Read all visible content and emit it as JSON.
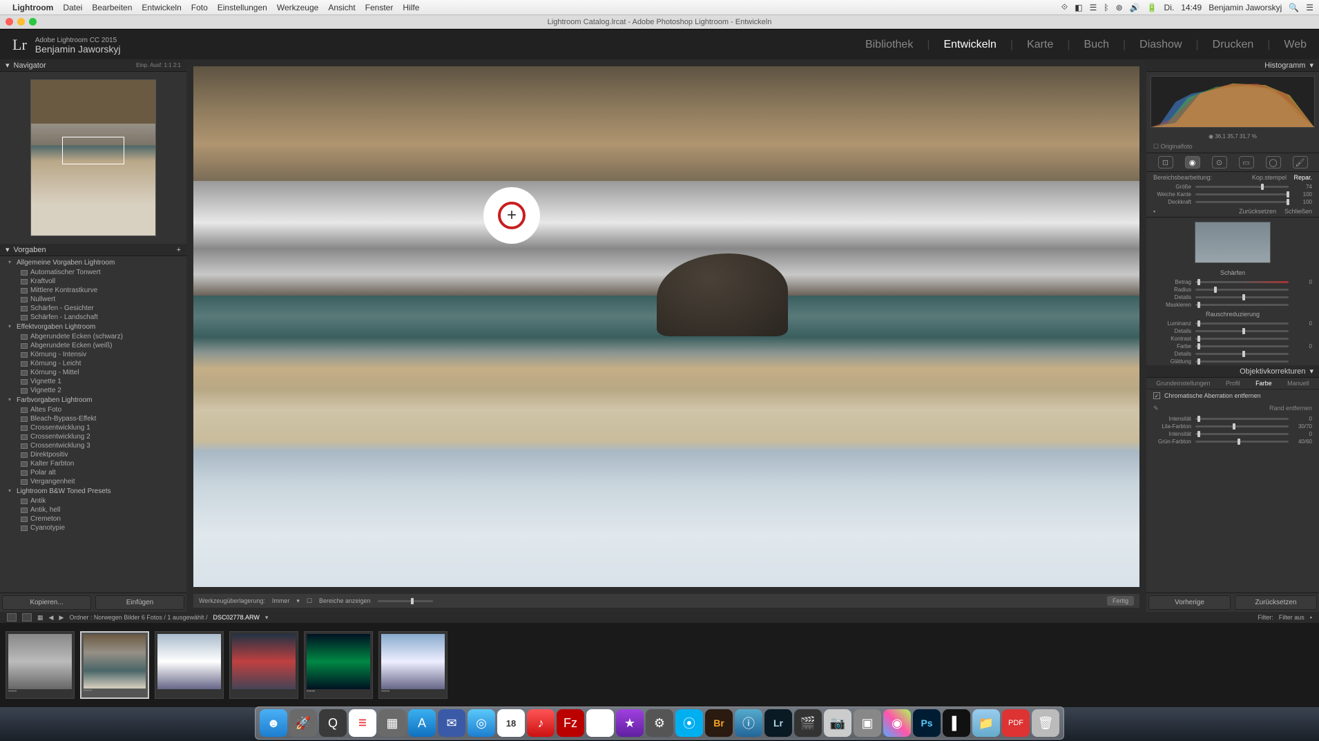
{
  "mac_menu": {
    "app": "Lightroom",
    "items": [
      "Datei",
      "Bearbeiten",
      "Entwickeln",
      "Foto",
      "Einstellungen",
      "Werkzeuge",
      "Ansicht",
      "Fenster",
      "Hilfe"
    ],
    "right_day": "Di.",
    "right_time": "14:49",
    "right_user": "Benjamin Jaworskyj"
  },
  "window_title": "Lightroom Catalog.lrcat - Adobe Photoshop Lightroom - Entwickeln",
  "lr": {
    "edition": "Adobe Lightroom CC 2015",
    "user": "Benjamin Jaworskyj",
    "modules": [
      "Bibliothek",
      "Entwickeln",
      "Karte",
      "Buch",
      "Diashow",
      "Drucken",
      "Web"
    ],
    "active_module": "Entwickeln"
  },
  "navigator": {
    "title": "Navigator",
    "zoom_labels": "Einp.   Ausf.   1:1   2:1"
  },
  "presets": {
    "title": "Vorgaben",
    "groups": [
      {
        "name": "Allgemeine Vorgaben Lightroom",
        "items": [
          "Automatischer Tonwert",
          "Kraftvoll",
          "Mittlere Kontrastkurve",
          "Nullwert",
          "Schärfen - Gesichter",
          "Schärfen - Landschaft"
        ]
      },
      {
        "name": "Effektvorgaben Lightroom",
        "items": [
          "Abgerundete Ecken (schwarz)",
          "Abgerundete Ecken (weiß)",
          "Körnung - Intensiv",
          "Körnung - Leicht",
          "Körnung - Mittel",
          "Vignette 1",
          "Vignette 2"
        ]
      },
      {
        "name": "Farbvorgaben Lightroom",
        "items": [
          "Altes Foto",
          "Bleach-Bypass-Effekt",
          "Crossentwicklung 1",
          "Crossentwicklung 2",
          "Crossentwicklung 3",
          "Direktpositiv",
          "Kalter Farbton",
          "Polar alt",
          "Vergangenheit"
        ]
      },
      {
        "name": "Lightroom B&W Toned Presets",
        "items": [
          "Antik",
          "Antik, hell",
          "Cremeton",
          "Cyanotypie"
        ]
      }
    ],
    "copy_btn": "Kopieren...",
    "paste_btn": "Einfügen"
  },
  "toolbar": {
    "overlay_label": "Werkzeugüberlagerung:",
    "overlay_value": "Immer",
    "show_areas": "Bereiche anzeigen",
    "done": "Fertig"
  },
  "histogram": {
    "title": "Histogramm",
    "readout": "◉  36,1    35,7    31,7 %",
    "original": "Originalfoto"
  },
  "spot": {
    "row_label": "Bereichsbearbeitung:",
    "mode1": "Kop.stempel",
    "mode2": "Repar.",
    "sliders": [
      {
        "label": "Größe",
        "value": "74",
        "pos": 70
      },
      {
        "label": "Weiche Kante",
        "value": "100",
        "pos": 98
      },
      {
        "label": "Deckkraft",
        "value": "100",
        "pos": 98
      }
    ],
    "reset": "Zurücksetzen",
    "close": "Schließen"
  },
  "detail": {
    "sharpen_title": "Schärfen",
    "sharpen": [
      {
        "label": "Betrag",
        "value": "0",
        "pos": 2
      },
      {
        "label": "Radius",
        "value": "",
        "pos": 20
      },
      {
        "label": "Details",
        "value": "",
        "pos": 50
      },
      {
        "label": "Maskieren",
        "value": "",
        "pos": 2
      }
    ],
    "noise_title": "Rauschreduzierung",
    "noise": [
      {
        "label": "Luminanz",
        "value": "0",
        "pos": 2
      },
      {
        "label": "Details",
        "value": "",
        "pos": 50
      },
      {
        "label": "Kontrast",
        "value": "",
        "pos": 2
      },
      {
        "label": "Farbe",
        "value": "0",
        "pos": 2
      },
      {
        "label": "Details",
        "value": "",
        "pos": 50
      },
      {
        "label": "Glättung",
        "value": "",
        "pos": 2
      }
    ]
  },
  "lens": {
    "title": "Objektivkorrekturen",
    "tabs": [
      "Grundeinstellungen",
      "Profil",
      "Farbe",
      "Manuell"
    ],
    "chrom": "Chromatische Aberration entfernen",
    "edge": "Rand entfernen",
    "sliders": [
      {
        "label": "Intensität",
        "value": "0",
        "pos": 2
      },
      {
        "label": "Lila-Farbton",
        "value": "30/70",
        "pos": 40
      },
      {
        "label": "Intensität",
        "value": "0",
        "pos": 2
      },
      {
        "label": "Grün-Farbton",
        "value": "40/60",
        "pos": 45
      }
    ]
  },
  "right_buttons": {
    "prev": "Vorherige",
    "reset": "Zurücksetzen"
  },
  "infobar": {
    "path": "Ordner :  Norwegen Bilder   6 Fotos /  1 ausgewählt /",
    "file": "DSC02778.ARW",
    "filter_label": "Filter:",
    "filter_value": "Filter aus"
  },
  "dock": {
    "cal1": "18",
    "cal2": "18",
    "br": "Br",
    "lr": "Lr",
    "ps": "Ps",
    "pdf": "PDF"
  }
}
